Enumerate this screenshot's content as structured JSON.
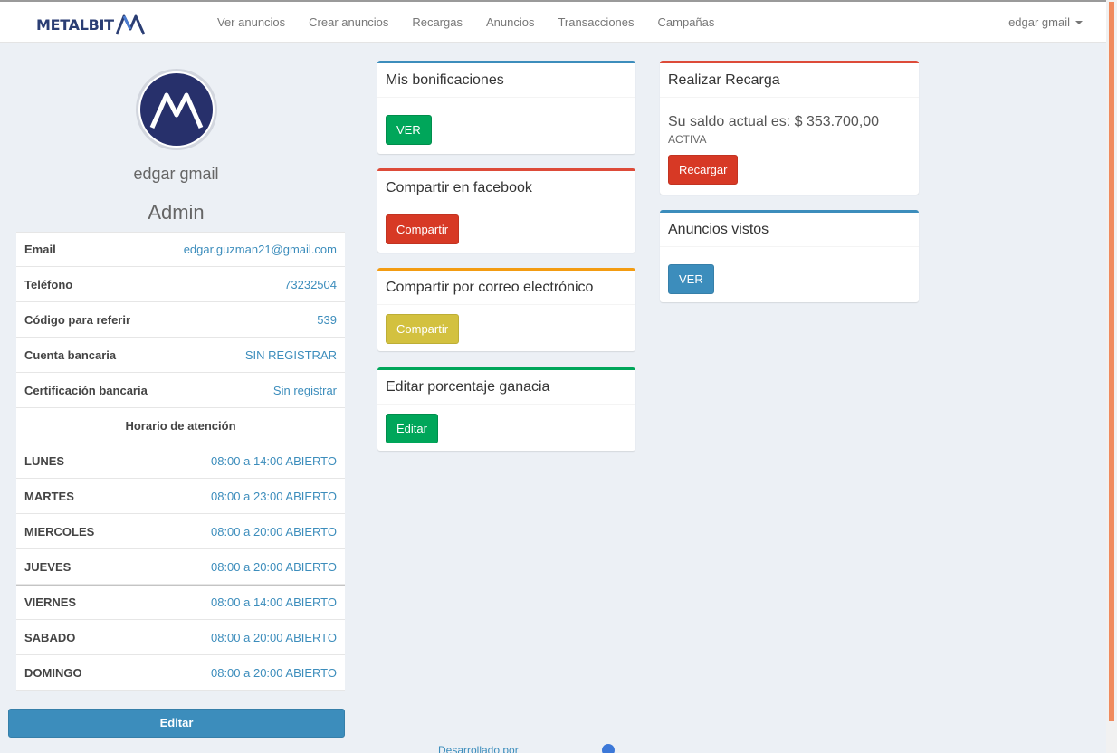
{
  "brand": {
    "name": "METALBIT"
  },
  "nav": {
    "links": [
      "Ver anuncios",
      "Crear anuncios",
      "Recargas",
      "Anuncios",
      "Transacciones",
      "Campañas"
    ],
    "user": "edgar gmail"
  },
  "profile": {
    "name": "edgar gmail",
    "role": "Admin",
    "email_label": "Email",
    "email": "edgar.guzman21@gmail.com",
    "phone_label": "Teléfono",
    "phone": "73232504",
    "referral_label": "Código para referir",
    "referral": "539",
    "bank_label": "Cuenta bancaria",
    "bank": "SIN REGISTRAR",
    "cert_label": "Certificación bancaria",
    "cert": "Sin registrar",
    "schedule_title": "Horario de atención",
    "schedule": [
      {
        "day": "LUNES",
        "hours": "08:00 a 14:00 ABIERTO"
      },
      {
        "day": "MARTES",
        "hours": "08:00 a 23:00 ABIERTO"
      },
      {
        "day": "MIERCOLES",
        "hours": "08:00 a 20:00 ABIERTO"
      },
      {
        "day": "JUEVES",
        "hours": "08:00 a 20:00 ABIERTO"
      },
      {
        "day": "VIERNES",
        "hours": "08:00 a 14:00 ABIERTO"
      },
      {
        "day": "SABADO",
        "hours": "08:00 a 20:00 ABIERTO"
      },
      {
        "day": "DOMINGO",
        "hours": "08:00 a 20:00 ABIERTO"
      }
    ],
    "edit_label": "Editar"
  },
  "boxes": {
    "bonuses": {
      "title": "Mis bonificaciones",
      "button": "VER",
      "color": "#3c8dbc"
    },
    "facebook": {
      "title": "Compartir en facebook",
      "button": "Compartir",
      "color": "#dd4b39"
    },
    "email_share": {
      "title": "Compartir por correo electrónico",
      "button": "Compartir",
      "color": "#f39c12"
    },
    "percentage": {
      "title": "Editar porcentaje ganacia",
      "button": "Editar",
      "color": "#00a65a"
    },
    "recharge": {
      "title": "Realizar Recarga",
      "balance": "Su saldo actual es: $ 353.700,00",
      "status": "ACTIVA",
      "button": "Recargar",
      "color": "#dd4b39"
    },
    "views": {
      "title": "Anuncios vistos",
      "button": "VER",
      "color": "#3c8dbc"
    }
  },
  "footer": {
    "text": "Desarrollado por"
  }
}
